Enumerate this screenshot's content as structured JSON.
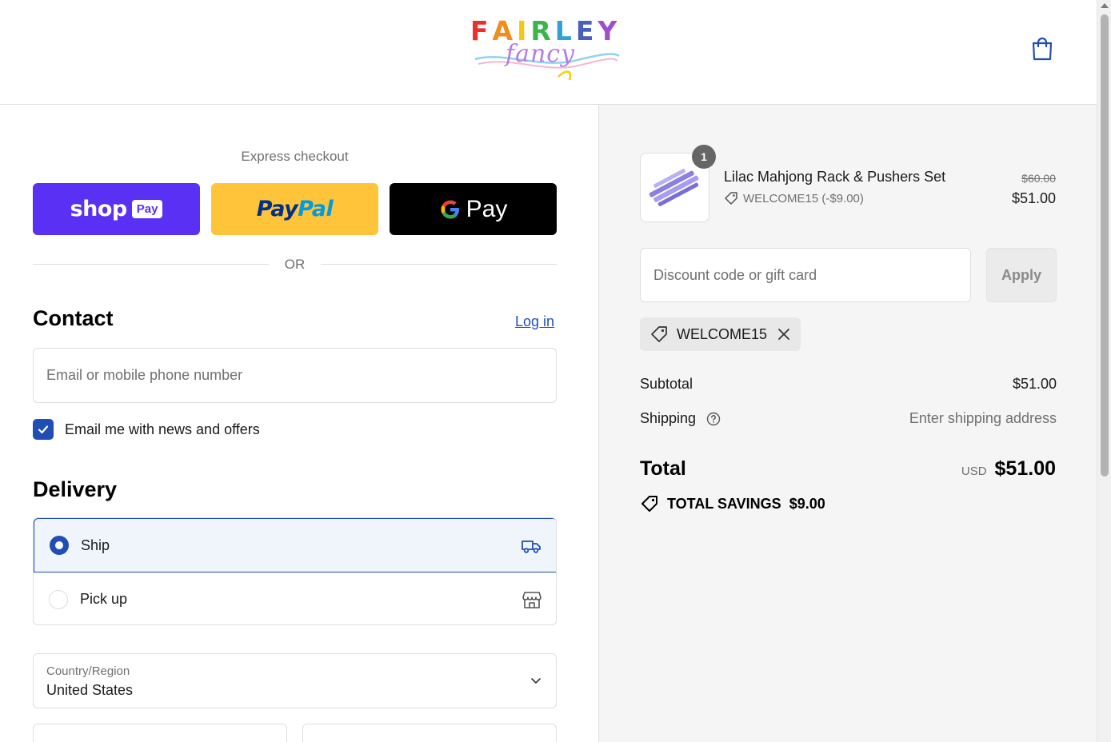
{
  "header": {
    "brand_top": "FAIRLEY",
    "brand_script": "fancy",
    "brand_colors": [
      "#e8312f",
      "#f28c1a",
      "#f5c518",
      "#3bb54a",
      "#2ea3d8",
      "#4a5fc1",
      "#9b4fd0"
    ],
    "cart_icon": "shopping-bag-icon"
  },
  "express": {
    "title": "Express checkout",
    "shop_word": "shop",
    "shop_pay": "Pay",
    "paypal_a": "Pay",
    "paypal_b": "Pal",
    "gpay_word": "Pay",
    "or": "OR"
  },
  "contact": {
    "title": "Contact",
    "login": "Log in",
    "email_placeholder": "Email or mobile phone number",
    "newsletter_label": "Email me with news and offers",
    "newsletter_checked": true
  },
  "delivery": {
    "title": "Delivery",
    "options": [
      {
        "label": "Ship",
        "selected": true,
        "icon": "truck-icon"
      },
      {
        "label": "Pick up",
        "selected": false,
        "icon": "store-icon"
      }
    ],
    "country_label": "Country/Region",
    "country_value": "United States"
  },
  "summary": {
    "item": {
      "name": "Lilac Mahjong Rack & Pushers Set",
      "quantity": "1",
      "discount": "WELCOME15 (-$9.00)",
      "old_price": "$60.00",
      "price": "$51.00"
    },
    "discount_placeholder": "Discount code or gift card",
    "apply": "Apply",
    "applied_code": "WELCOME15",
    "subtotal_label": "Subtotal",
    "subtotal_value": "$51.00",
    "shipping_label": "Shipping",
    "shipping_value": "Enter shipping address",
    "total_label": "Total",
    "currency": "USD",
    "total_value": "$51.00",
    "savings_label": "TOTAL SAVINGS",
    "savings_value": "$9.00"
  },
  "colors": {
    "accent": "#1f4fb5",
    "shop_pay": "#5a31f4",
    "paypal": "#ffc439",
    "gpay": "#000000",
    "summary_bg": "#f5f5f5"
  }
}
